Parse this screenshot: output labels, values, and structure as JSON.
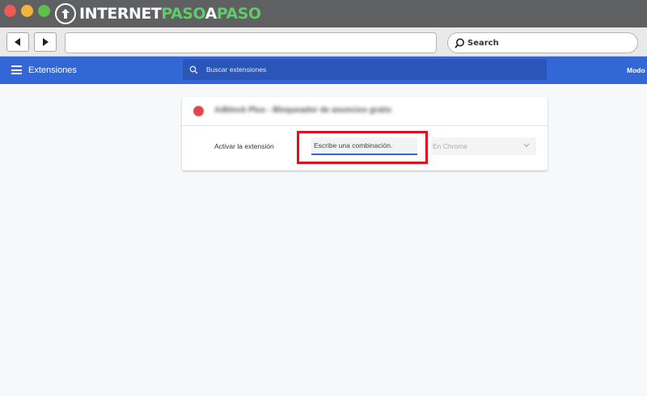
{
  "window": {
    "brand": {
      "part1": "INTERNET",
      "part2": "PASO",
      "part3": "A",
      "part4": "PASO"
    }
  },
  "toolbar": {
    "back_icon": "back-arrow-icon",
    "forward_icon": "forward-arrow-icon",
    "address_value": "",
    "search_label": "Search"
  },
  "extensions_header": {
    "title": "Extensiones",
    "search_placeholder": "Buscar extensiones",
    "mode_label": "Modo"
  },
  "shortcut_card": {
    "extension_name": "Adblock Plus - Bloqueador de anuncios gratis",
    "shortcut_label": "Activar la extensión",
    "shortcut_placeholder": "Escribe una combinación.",
    "scope_selected": "En Chrome"
  },
  "colors": {
    "header_blue": "#3367d6",
    "highlight_red": "#e3101c",
    "brand_green": "#63c96a"
  }
}
